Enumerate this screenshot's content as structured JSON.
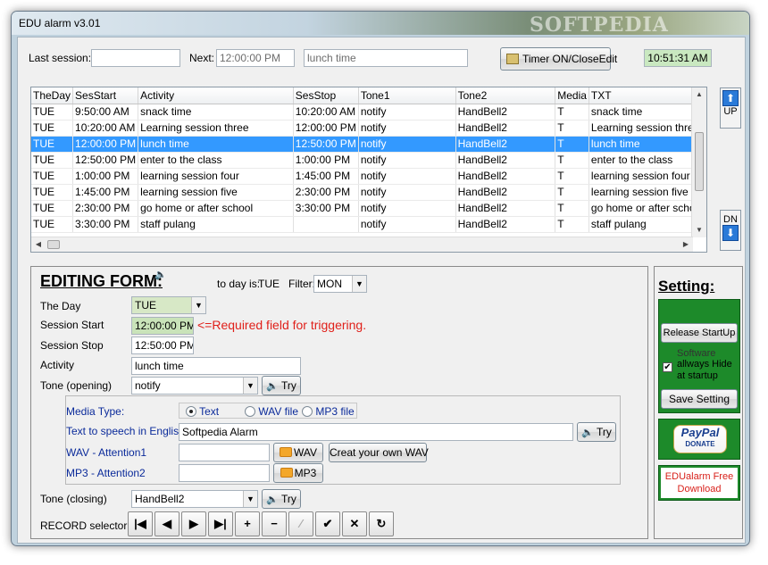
{
  "window": {
    "title": "EDU alarm v3.01",
    "watermark": "SOFTPEDIA"
  },
  "top": {
    "last_session_label": "Last session:",
    "last_session_value": "",
    "next_label": "Next:",
    "next_time": "12:00:00 PM",
    "next_activity": "lunch time",
    "timer_button": "Timer ON/CloseEdit",
    "clock": "10:51:31 AM"
  },
  "grid": {
    "columns": [
      "TheDay",
      "SesStart",
      "Activity",
      "SesStop",
      "Tone1",
      "Tone2",
      "Media",
      "TXT"
    ],
    "rows": [
      [
        "TUE",
        "9:50:00 AM",
        "snack time",
        "10:20:00 AM",
        "notify",
        "HandBell2",
        "T",
        "snack time"
      ],
      [
        "TUE",
        "10:20:00 AM",
        "Learning session three",
        "12:00:00 PM",
        "notify",
        "HandBell2",
        "T",
        "Learning session three"
      ],
      [
        "TUE",
        "12:00:00 PM",
        "lunch time",
        "12:50:00 PM",
        "notify",
        "HandBell2",
        "T",
        "lunch time"
      ],
      [
        "TUE",
        "12:50:00 PM",
        "enter to the class",
        "1:00:00 PM",
        "notify",
        "HandBell2",
        "T",
        "enter to the class"
      ],
      [
        "TUE",
        "1:00:00 PM",
        "learning session four",
        "1:45:00 PM",
        "notify",
        "HandBell2",
        "T",
        "learning session four"
      ],
      [
        "TUE",
        "1:45:00 PM",
        "learning session five",
        "2:30:00 PM",
        "notify",
        "HandBell2",
        "T",
        "learning session five"
      ],
      [
        "TUE",
        "2:30:00 PM",
        "go home or after school",
        "3:30:00 PM",
        "notify",
        "HandBell2",
        "T",
        "go home or after school"
      ],
      [
        "TUE",
        "3:30:00 PM",
        "staff pulang",
        "",
        "notify",
        "HandBell2",
        "T",
        "staff pulang"
      ]
    ],
    "selected_row": 2
  },
  "nav": {
    "up_label": "UP",
    "dn_label": "DN"
  },
  "form": {
    "title": "EDITING FORM:",
    "today_label": "to day is:",
    "today_value": "TUE",
    "filter_label": "Filter:",
    "filter_value": "MON",
    "the_day_label": "The Day",
    "the_day_value": "TUE",
    "session_start_label": "Session Start",
    "session_start_value": "12:00:00 PM",
    "required_note": "<=Required field for triggering.",
    "session_stop_label": "Session Stop",
    "session_stop_value": "12:50:00 PM",
    "activity_label": "Activity",
    "activity_value": "lunch time",
    "tone_opening_label": "Tone (opening)",
    "tone_opening_value": "notify",
    "try_label": "Try",
    "media_type_label": "Media Type:",
    "media_text": "Text",
    "media_wav": "WAV file",
    "media_mp3": "MP3 file",
    "tts_label": "Text to speech in English.",
    "tts_value": "Softpedia Alarm",
    "wav_label": "WAV - Attention1",
    "wav_button": "WAV",
    "create_wav_button": "Creat your own WAV",
    "mp3_label": "MP3 - Attention2",
    "mp3_button": "MP3",
    "tone_closing_label": "Tone (closing)",
    "tone_closing_value": "HandBell2",
    "record_selector_label": "RECORD selector:"
  },
  "record_buttons": [
    "|◀",
    "◀",
    "▶",
    "▶|",
    "+",
    "−",
    "⁄",
    "✔",
    "✕",
    "↻"
  ],
  "setting": {
    "title": "Setting:",
    "release_button": "Release StartUp",
    "software_text": "Software",
    "hide_checkbox_label": "allways Hide at startup",
    "save_button": "Save Setting",
    "paypal_text": "PayPal",
    "donate_text": "DONATE",
    "free_download": "EDUalarm Free Download"
  }
}
